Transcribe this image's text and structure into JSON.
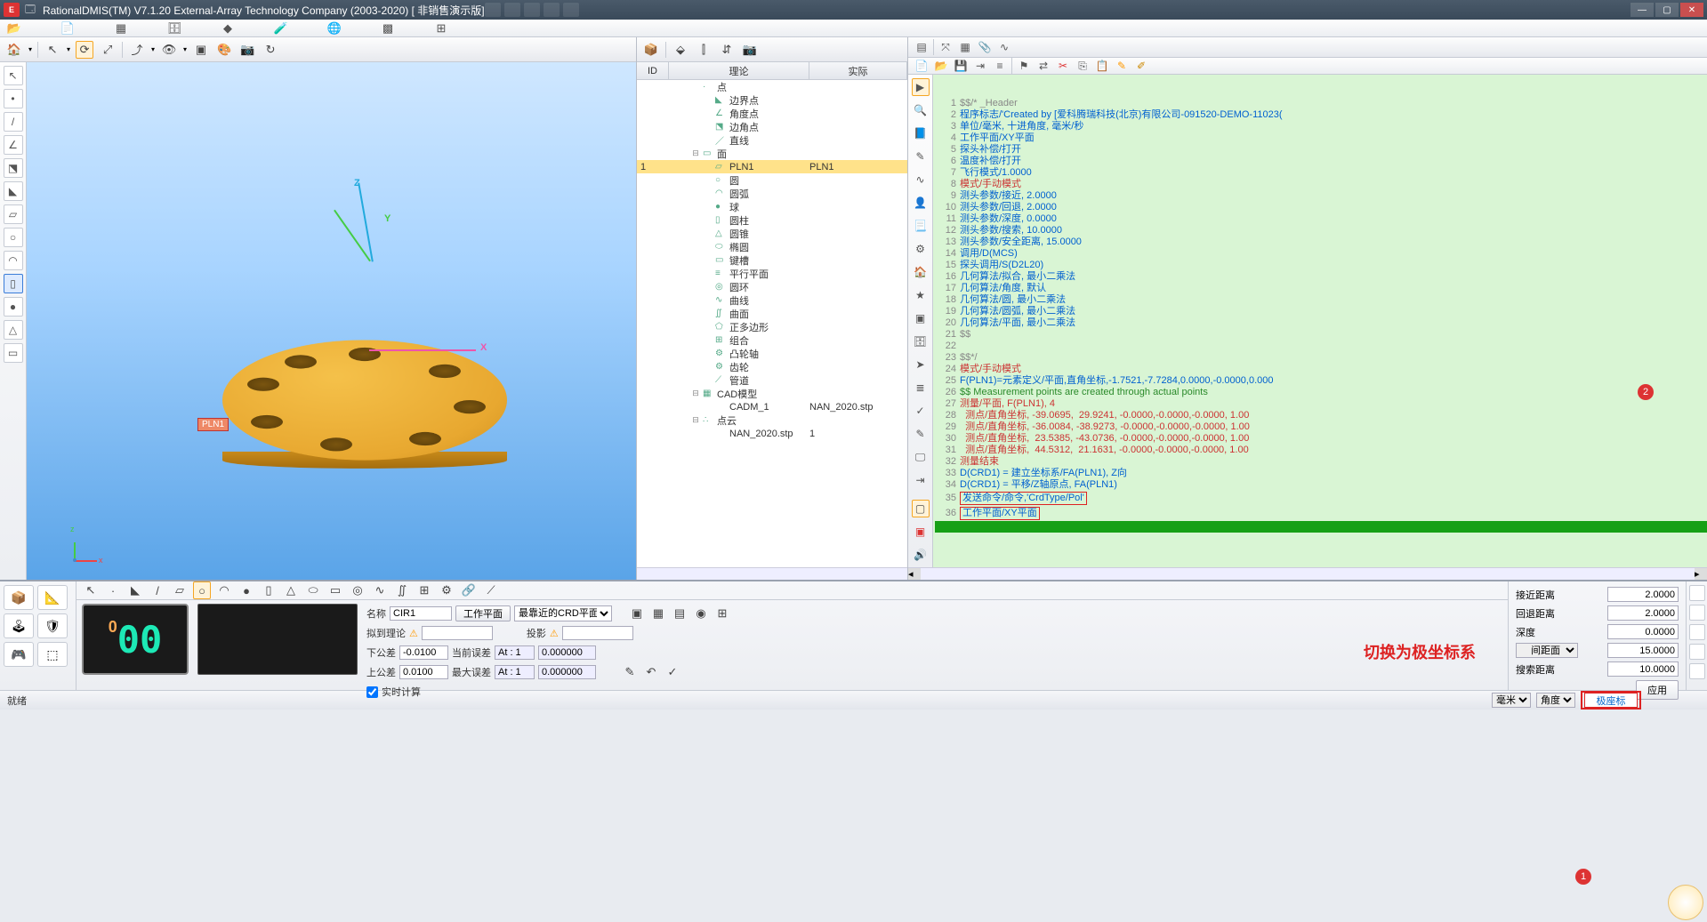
{
  "title": "RationalDMIS(TM) V7.1.20    External-Array Technology Company (2003-2020) [ 非销售演示版]",
  "tree": {
    "headers": {
      "id": "ID",
      "theory": "理论",
      "actual": "实际"
    },
    "items": [
      {
        "indent": 1,
        "exp": "",
        "label": "点",
        "ico": "·"
      },
      {
        "indent": 2,
        "exp": "",
        "label": "边界点",
        "ico": "◣"
      },
      {
        "indent": 2,
        "exp": "",
        "label": "角度点",
        "ico": "∠"
      },
      {
        "indent": 2,
        "exp": "",
        "label": "边角点",
        "ico": "⬔"
      },
      {
        "indent": 2,
        "exp": "",
        "label": "直线",
        "ico": "／"
      },
      {
        "indent": 1,
        "exp": "⊟",
        "label": "面",
        "ico": "▭"
      },
      {
        "indent": 2,
        "exp": "",
        "id": "1",
        "label": "PLN1",
        "actual": "PLN1",
        "sel": true,
        "ico": "▱"
      },
      {
        "indent": 2,
        "exp": "",
        "label": "圆",
        "ico": "○"
      },
      {
        "indent": 2,
        "exp": "",
        "label": "圆弧",
        "ico": "◠"
      },
      {
        "indent": 2,
        "exp": "",
        "label": "球",
        "ico": "●"
      },
      {
        "indent": 2,
        "exp": "",
        "label": "圆柱",
        "ico": "▯"
      },
      {
        "indent": 2,
        "exp": "",
        "label": "圆锥",
        "ico": "△"
      },
      {
        "indent": 2,
        "exp": "",
        "label": "椭圆",
        "ico": "⬭"
      },
      {
        "indent": 2,
        "exp": "",
        "label": "键槽",
        "ico": "▭"
      },
      {
        "indent": 2,
        "exp": "",
        "label": "平行平面",
        "ico": "≡"
      },
      {
        "indent": 2,
        "exp": "",
        "label": "圆环",
        "ico": "◎"
      },
      {
        "indent": 2,
        "exp": "",
        "label": "曲线",
        "ico": "∿"
      },
      {
        "indent": 2,
        "exp": "",
        "label": "曲面",
        "ico": "∬"
      },
      {
        "indent": 2,
        "exp": "",
        "label": "正多边形",
        "ico": "⬠"
      },
      {
        "indent": 2,
        "exp": "",
        "label": "组合",
        "ico": "⊞"
      },
      {
        "indent": 2,
        "exp": "",
        "label": "凸轮轴",
        "ico": "⚙"
      },
      {
        "indent": 2,
        "exp": "",
        "label": "齿轮",
        "ico": "⚙"
      },
      {
        "indent": 2,
        "exp": "",
        "label": "管道",
        "ico": "⟋"
      },
      {
        "indent": 1,
        "exp": "⊟",
        "label": "CAD模型",
        "ico": "▦"
      },
      {
        "indent": 2,
        "exp": "",
        "label": "CADM_1",
        "actual": "NAN_2020.stp",
        "ico": ""
      },
      {
        "indent": 1,
        "exp": "⊟",
        "label": "点云",
        "ico": "∴"
      },
      {
        "indent": 2,
        "exp": "",
        "label": "NAN_2020.stp",
        "actual": "1",
        "ico": ""
      }
    ]
  },
  "viewport": {
    "pln_label": "PLN1"
  },
  "code": {
    "lines": [
      {
        "n": 1,
        "c": "gray",
        "t": "$$/* _Header"
      },
      {
        "n": 2,
        "c": "blue",
        "t": "程序标志/'Created by [爱科腾瑞科技(北京)有限公司-091520-DEMO-11023("
      },
      {
        "n": 3,
        "c": "blue",
        "t": "单位/毫米, 十进角度, 毫米/秒"
      },
      {
        "n": 4,
        "c": "blue",
        "t": "工作平面/XY平面"
      },
      {
        "n": 5,
        "c": "blue",
        "t": "探头补偿/打开"
      },
      {
        "n": 6,
        "c": "blue",
        "t": "温度补偿/打开"
      },
      {
        "n": 7,
        "c": "blue",
        "t": "飞行模式/1.0000"
      },
      {
        "n": 8,
        "c": "red",
        "t": "模式/手动模式"
      },
      {
        "n": 9,
        "c": "blue",
        "t": "测头参数/接近, 2.0000"
      },
      {
        "n": 10,
        "c": "blue",
        "t": "测头参数/回退, 2.0000"
      },
      {
        "n": 11,
        "c": "blue",
        "t": "测头参数/深度, 0.0000"
      },
      {
        "n": 12,
        "c": "blue",
        "t": "测头参数/搜索, 10.0000"
      },
      {
        "n": 13,
        "c": "blue",
        "t": "测头参数/安全距离, 15.0000"
      },
      {
        "n": 14,
        "c": "blue",
        "t": "调用/D(MCS)"
      },
      {
        "n": 15,
        "c": "blue",
        "t": "探头调用/S(D2L20)"
      },
      {
        "n": 16,
        "c": "blue",
        "t": "几何算法/拟合, 最小二乘法"
      },
      {
        "n": 17,
        "c": "blue",
        "t": "几何算法/角度, 默认"
      },
      {
        "n": 18,
        "c": "blue",
        "t": "几何算法/圆, 最小二乘法"
      },
      {
        "n": 19,
        "c": "blue",
        "t": "几何算法/圆弧, 最小二乘法"
      },
      {
        "n": 20,
        "c": "blue",
        "t": "几何算法/平面, 最小二乘法"
      },
      {
        "n": 21,
        "c": "gray",
        "t": "$$"
      },
      {
        "n": 22,
        "c": "gray",
        "t": ""
      },
      {
        "n": 23,
        "c": "gray",
        "t": "$$*/"
      },
      {
        "n": 24,
        "c": "red",
        "t": "模式/手动模式"
      },
      {
        "n": 25,
        "c": "blue",
        "t": "F(PLN1)=元素定义/平面,直角坐标,-1.7521,-7.7284,0.0000,-0.0000,0.000"
      },
      {
        "n": 26,
        "c": "grn",
        "t": "$$ Measurement points are created through actual points"
      },
      {
        "n": 27,
        "c": "red",
        "t": "测量/平面, F(PLN1), 4"
      },
      {
        "n": 28,
        "c": "red",
        "t": "  测点/直角坐标, -39.0695,  29.9241, -0.0000,-0.0000,-0.0000, 1.00"
      },
      {
        "n": 29,
        "c": "red",
        "t": "  测点/直角坐标, -36.0084, -38.9273, -0.0000,-0.0000,-0.0000, 1.00"
      },
      {
        "n": 30,
        "c": "red",
        "t": "  测点/直角坐标,  23.5385, -43.0736, -0.0000,-0.0000,-0.0000, 1.00"
      },
      {
        "n": 31,
        "c": "red",
        "t": "  测点/直角坐标,  44.5312,  21.1631, -0.0000,-0.0000,-0.0000, 1.00"
      },
      {
        "n": 32,
        "c": "red",
        "t": "测量结束"
      },
      {
        "n": 33,
        "c": "blue",
        "t": "D(CRD1) = 建立坐标系/FA(PLN1), Z向"
      },
      {
        "n": 34,
        "c": "blue",
        "t": "D(CRD1) = 平移/Z轴原点, FA(PLN1)"
      },
      {
        "n": 35,
        "c": "blue",
        "t": "发送命令/命令,'CrdType/Pol'",
        "box": true
      },
      {
        "n": 36,
        "c": "blue",
        "t": "工作平面/XY平面",
        "box": true
      },
      {
        "n": 37,
        "c": "hl",
        "t": " "
      }
    ]
  },
  "bottom": {
    "name_label": "名称",
    "name_value": "CIR1",
    "workplane_btn": "工作平面",
    "crd_select": "最靠近的CRD平面",
    "dro": "000",
    "fit_label": "拟到理论",
    "fit_warn": "⚠",
    "proj_label": "投影",
    "proj_warn": "⚠",
    "lower_tol_label": "下公差",
    "lower_tol": "-0.0100",
    "upper_tol_label": "上公差",
    "upper_tol": "0.0100",
    "cur_dev_label": "当前误差",
    "cur_dev_at": "At : 1",
    "cur_dev": "0.000000",
    "max_dev_label": "最大误差",
    "max_dev_at": "At : 1",
    "max_dev": "0.000000",
    "realtime_label": "实时计算",
    "red_text": "切换为极坐标系",
    "right": {
      "approach_label": "接近距离",
      "approach": "2.0000",
      "retreat_label": "回退距离",
      "retreat": "2.0000",
      "depth_label": "深度",
      "depth": "0.0000",
      "gap_label_sel": "间距面",
      "gap": "15.0000",
      "search_label": "搜索距离",
      "search": "10.0000",
      "apply": "应用"
    }
  },
  "status": {
    "ready": "就绪",
    "unit1": "毫米",
    "unit2": "角度",
    "unit3_value": "极座标",
    "badge1": "1",
    "badge2": "2"
  }
}
